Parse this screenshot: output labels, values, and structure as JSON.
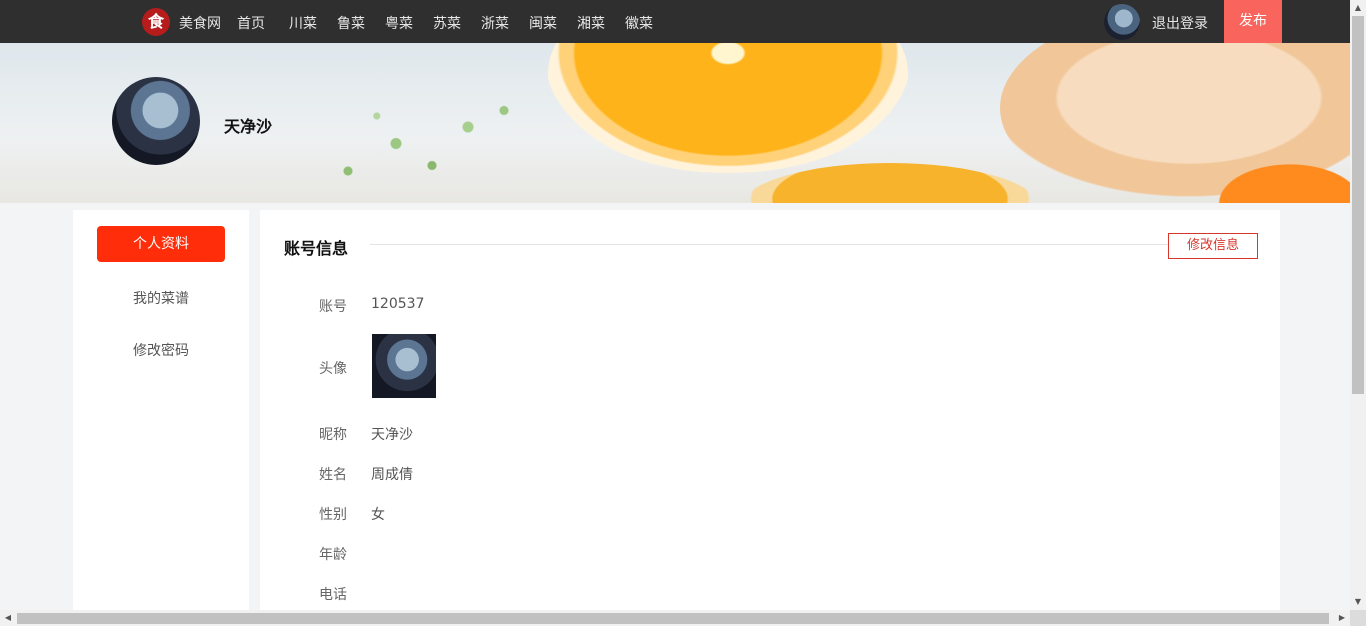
{
  "nav": {
    "logo_char": "食",
    "brand": "美食网",
    "links": [
      "首页",
      "川菜",
      "鲁菜",
      "粤菜",
      "苏菜",
      "浙菜",
      "闽菜",
      "湘菜",
      "徽菜"
    ],
    "logout": "退出登录",
    "publish": "发布"
  },
  "banner": {
    "nickname": "天净沙"
  },
  "sidebar": {
    "items": [
      {
        "label": "个人资料",
        "active": true
      },
      {
        "label": "我的菜谱",
        "active": false
      },
      {
        "label": "修改密码",
        "active": false
      }
    ]
  },
  "account": {
    "title": "账号信息",
    "edit_label": "修改信息",
    "rows": [
      {
        "label": "账号",
        "value": "120537"
      },
      {
        "label": "头像",
        "value": ""
      },
      {
        "label": "昵称",
        "value": "天净沙"
      },
      {
        "label": "姓名",
        "value": "周成倩"
      },
      {
        "label": "性别",
        "value": "女"
      },
      {
        "label": "年龄",
        "value": ""
      },
      {
        "label": "电话",
        "value": ""
      }
    ]
  },
  "colors": {
    "accent": "#ff2d0a",
    "publish": "#f9645c",
    "nav_bg": "#2f2f2f",
    "edit_border": "#d9362b"
  },
  "icons": {
    "logo": "site-logo-icon",
    "scroll_up": "arrow-up-icon",
    "scroll_down": "arrow-down-icon",
    "scroll_left": "arrow-left-icon",
    "scroll_right": "arrow-right-icon"
  }
}
